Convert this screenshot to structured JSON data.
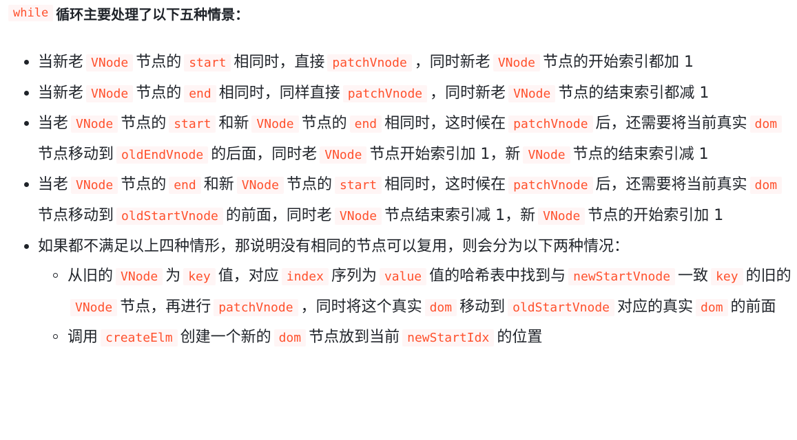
{
  "heading": {
    "code": "while",
    "text": "循环主要处理了以下五种情景："
  },
  "items": [
    {
      "parts": [
        {
          "t": "当新老"
        },
        {
          "c": "VNode"
        },
        {
          "t": "节点的"
        },
        {
          "c": "start"
        },
        {
          "t": "相同时，直接"
        },
        {
          "c": "patchVnode"
        },
        {
          "t": "，同时新老"
        },
        {
          "c": "VNode"
        },
        {
          "t": "节点的开始索引都加 1"
        }
      ]
    },
    {
      "parts": [
        {
          "t": "当新老"
        },
        {
          "c": "VNode"
        },
        {
          "t": "节点的"
        },
        {
          "c": "end"
        },
        {
          "t": "相同时，同样直接"
        },
        {
          "c": "patchVnode"
        },
        {
          "t": "，同时新老"
        },
        {
          "c": "VNode"
        },
        {
          "t": "节点的结束索引都减 1"
        }
      ]
    },
    {
      "parts": [
        {
          "t": "当老"
        },
        {
          "c": "VNode"
        },
        {
          "t": "节点的"
        },
        {
          "c": "start"
        },
        {
          "t": "和新"
        },
        {
          "c": "VNode"
        },
        {
          "t": "节点的"
        },
        {
          "c": "end"
        },
        {
          "t": "相同时，这时候在"
        },
        {
          "c": "patchVnode"
        },
        {
          "t": "后，还需要将当前真实"
        },
        {
          "c": "dom"
        },
        {
          "t": "节点移动到"
        },
        {
          "c": "oldEndVnode"
        },
        {
          "t": "的后面，同时老"
        },
        {
          "c": "VNode"
        },
        {
          "t": "节点开始索引加 1，新"
        },
        {
          "c": "VNode"
        },
        {
          "t": "节点的结束索引减 1"
        }
      ]
    },
    {
      "parts": [
        {
          "t": "当老"
        },
        {
          "c": "VNode"
        },
        {
          "t": "节点的"
        },
        {
          "c": "end"
        },
        {
          "t": "和新"
        },
        {
          "c": "VNode"
        },
        {
          "t": "节点的"
        },
        {
          "c": "start"
        },
        {
          "t": "相同时，这时候在"
        },
        {
          "c": "patchVnode"
        },
        {
          "t": "后，还需要将当前真实"
        },
        {
          "c": "dom"
        },
        {
          "t": "节点移动到"
        },
        {
          "c": "oldStartVnode"
        },
        {
          "t": "的前面，同时老"
        },
        {
          "c": "VNode"
        },
        {
          "t": "节点结束索引减 1，新"
        },
        {
          "c": "VNode"
        },
        {
          "t": "节点的开始索引加 1"
        }
      ]
    },
    {
      "parts": [
        {
          "t": "如果都不满足以上四种情形，那说明没有相同的节点可以复用，则会分为以下两种情况："
        }
      ],
      "children": [
        {
          "parts": [
            {
              "t": "从旧的"
            },
            {
              "c": "VNode"
            },
            {
              "t": "为"
            },
            {
              "c": "key"
            },
            {
              "t": "值，对应"
            },
            {
              "c": "index"
            },
            {
              "t": "序列为"
            },
            {
              "c": "value"
            },
            {
              "t": "值的哈希表中找到与"
            },
            {
              "c": "newStartVnode"
            },
            {
              "t": "一致"
            },
            {
              "c": "key"
            },
            {
              "t": "的旧的"
            },
            {
              "c": "VNode"
            },
            {
              "t": "节点，再进行"
            },
            {
              "c": "patchVnode"
            },
            {
              "t": "，同时将这个真实"
            },
            {
              "c": "dom"
            },
            {
              "t": "移动到"
            },
            {
              "c": "oldStartVnode"
            },
            {
              "t": "对应的真实"
            },
            {
              "c": "dom"
            },
            {
              "t": "的前面"
            }
          ]
        },
        {
          "parts": [
            {
              "t": "调用"
            },
            {
              "c": "createElm"
            },
            {
              "t": "创建一个新的"
            },
            {
              "c": "dom"
            },
            {
              "t": "节点放到当前"
            },
            {
              "c": "newStartIdx"
            },
            {
              "t": "的位置"
            }
          ]
        }
      ]
    }
  ]
}
